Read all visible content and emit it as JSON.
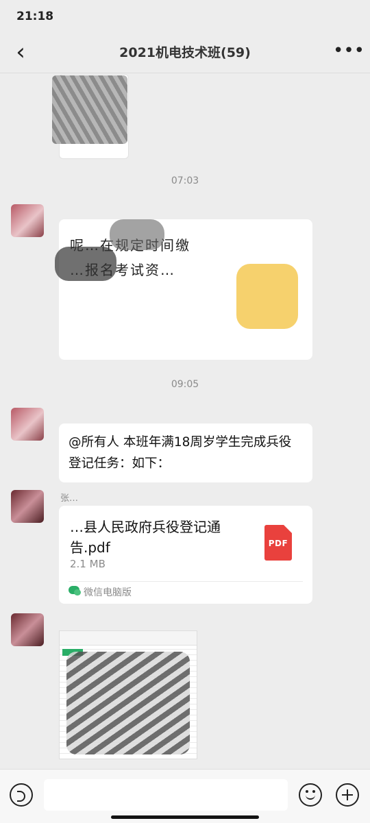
{
  "status": {
    "time": "21:18"
  },
  "header": {
    "title": "2021机电技术班(59)",
    "back_icon": "chevron-left-icon",
    "more_icon": "more-dots-icon"
  },
  "timestamps": [
    "07:03",
    "09:05"
  ],
  "messages": {
    "notice_text_line1": "呢…在规定时间缴",
    "notice_text_line2": "…报名考试资…",
    "mention_text": "@所有人  本班年满18周岁学生完成兵役登记任务：如下：",
    "file": {
      "name": "…县人民政府兵役登记通告.pdf",
      "size": "2.1 MB",
      "type_label": "PDF",
      "source": "微信电脑版"
    },
    "sender_partial": "张…"
  },
  "bottom_bar": {
    "voice_icon": "voice-icon",
    "emoji_icon": "emoji-icon",
    "plus_icon": "plus-icon"
  },
  "colors": {
    "background": "#ededed",
    "bubble": "#ffffff",
    "pdf": "#e9413d",
    "wechat_green": "#2aae67"
  }
}
